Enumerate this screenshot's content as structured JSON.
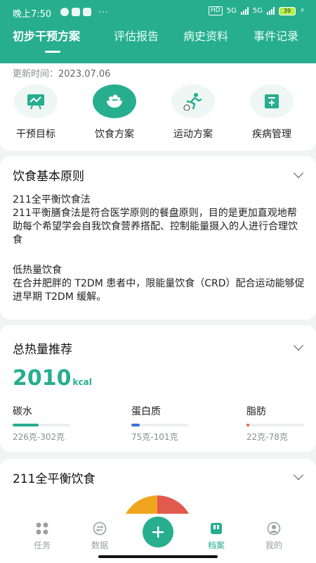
{
  "status_bar": {
    "time": "晚上7:50",
    "more": "···",
    "hd": "HD",
    "net1": "5G",
    "net2": "5G",
    "battery": "39"
  },
  "tabs": [
    {
      "label": "初步干预方案",
      "active": true
    },
    {
      "label": "评估报告",
      "active": false
    },
    {
      "label": "病史资料",
      "active": false
    },
    {
      "label": "事件记录",
      "active": false
    }
  ],
  "update": {
    "label": "更新时间：",
    "value": "2023.07.06"
  },
  "quick_nav": [
    {
      "label": "干预目标",
      "icon": "chart-board-icon",
      "active": false
    },
    {
      "label": "饮食方案",
      "icon": "food-bowl-icon",
      "active": true
    },
    {
      "label": "运动方案",
      "icon": "running-icon",
      "active": false
    },
    {
      "label": "疾病管理",
      "icon": "medical-kit-icon",
      "active": false
    }
  ],
  "diet_principles": {
    "title": "饮食基本原则",
    "p1_title": "211全平衡饮食法",
    "p1_body": "211平衡膳食法是符合医学原则的餐盘原则，目的是更加直观地帮助每个希望学会自我饮食营养搭配、控制能量摄入的人进行合理饮食",
    "p2_title": "低热量饮食",
    "p2_body": "在合并肥胖的 T2DM 患者中，限能量饮食（CRD）配合运动能够促进早期 T2DM 缓解。"
  },
  "calories": {
    "title": "总热量推荐",
    "value": "2010",
    "unit": "kcal",
    "macros": [
      {
        "name": "碳水",
        "range": "226克-302克",
        "fill": 0.45,
        "color": "#27ae8f"
      },
      {
        "name": "蛋白质",
        "range": "75克-101克",
        "fill": 0.15,
        "color": "#3a6fd8"
      },
      {
        "name": "脂肪",
        "range": "22克-78克",
        "fill": 0.05,
        "color": "#e25a4e"
      }
    ]
  },
  "balance": {
    "title": "211全平衡饮食"
  },
  "bottom_nav": [
    {
      "label": "任务",
      "icon": "task-grid-icon",
      "active": false
    },
    {
      "label": "数据",
      "icon": "data-exchange-icon",
      "active": false
    },
    {
      "label": "",
      "icon": "plus-icon",
      "active": false
    },
    {
      "label": "档案",
      "icon": "archive-icon",
      "active": true
    },
    {
      "label": "我的",
      "icon": "profile-icon",
      "active": false
    }
  ],
  "colors": {
    "accent": "#27ae8f",
    "background": "#f2f4f3"
  }
}
